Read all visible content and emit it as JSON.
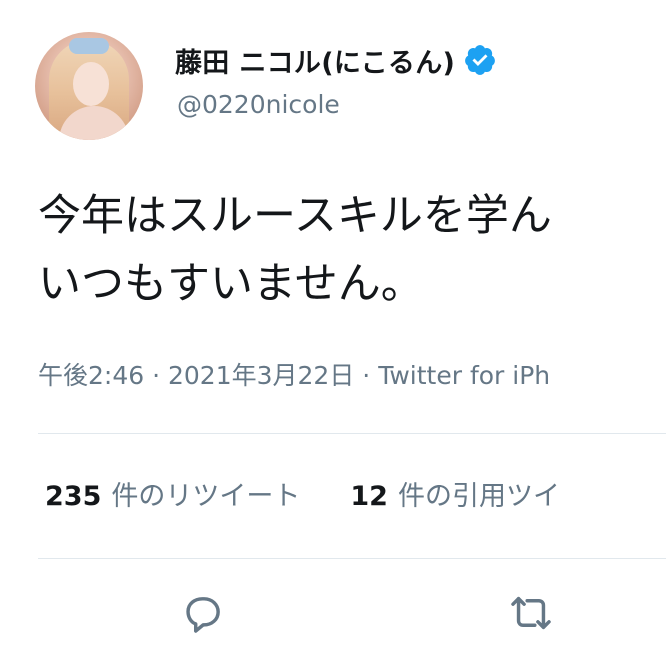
{
  "author": {
    "display_name": "藤田 ニコル(にこるん)",
    "handle": "@0220nicole",
    "verified": true
  },
  "tweet": {
    "lines": [
      "今年はスルースキルを学ん",
      "いつもすいません。"
    ]
  },
  "meta": {
    "time": "午後2:46",
    "date": "2021年3月22日",
    "source": "Twitter for iPh"
  },
  "stats": {
    "retweets_count": "235",
    "retweets_label": "件のリツイート",
    "quotes_count": "12",
    "quotes_label": "件の引用ツイ"
  },
  "icons": {
    "avatar": "avatar",
    "verified": "verified-badge-icon",
    "reply": "reply-icon",
    "retweet": "retweet-icon"
  },
  "colors": {
    "verified": "#1da1f2",
    "secondary_text": "#657786",
    "divider": "#e1e8ed"
  }
}
